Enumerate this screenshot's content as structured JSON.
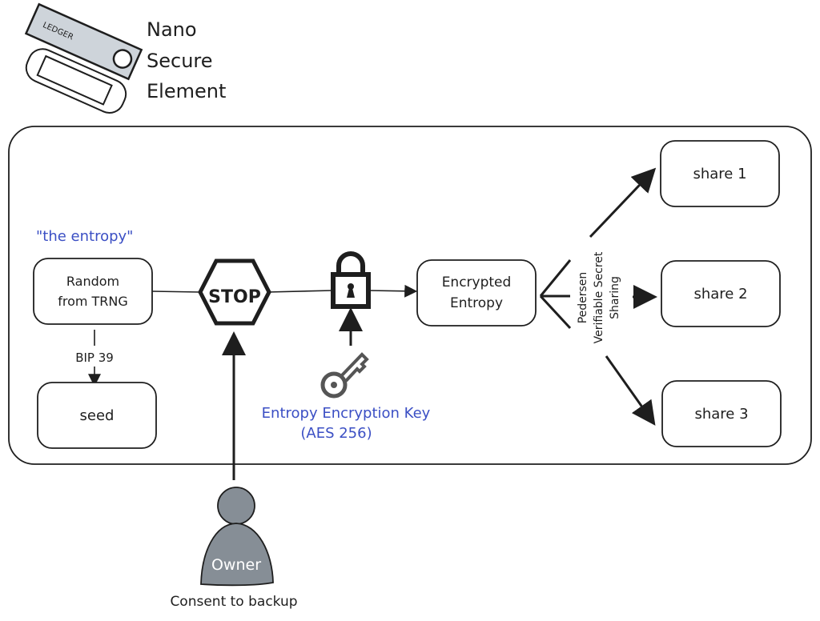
{
  "header": {
    "title_lines": [
      "Nano",
      "Secure",
      "Element"
    ],
    "device_brand": "LEDGER"
  },
  "labels": {
    "entropy_caption": "\"the entropy\"",
    "random_lines": [
      "Random",
      "from TRNG"
    ],
    "bip39": "BIP 39",
    "seed": "seed",
    "stop": "STOP",
    "encrypted_lines": [
      "Encrypted",
      "Entropy"
    ],
    "key_lines": [
      "Entropy Encryption Key",
      "(AES 256)"
    ],
    "vss_lines": [
      "Pedersen",
      "Verifiable Secret",
      "Sharing"
    ],
    "shares": [
      "share 1",
      "share 2",
      "share 3"
    ],
    "owner": "Owner",
    "consent": "Consent to backup"
  },
  "colors": {
    "ink": "#1e1e1e",
    "accent_blue": "#3b4fc4",
    "owner_fill": "#868e96",
    "device_fill": "#ced4da"
  }
}
